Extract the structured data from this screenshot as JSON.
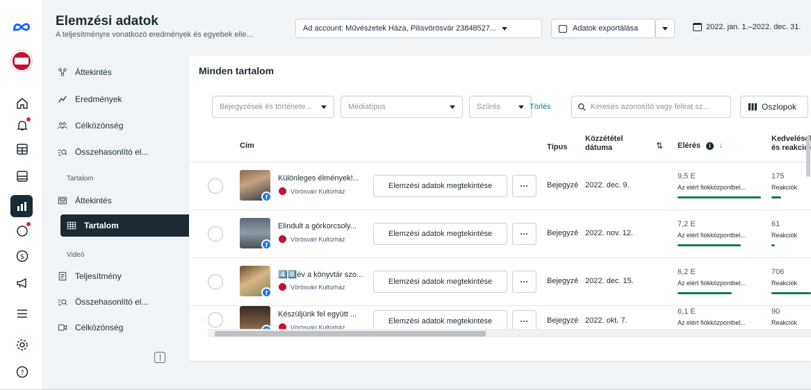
{
  "header": {
    "title": "Elemzési adatok",
    "subtitle": "A teljesítményre vonatkozó eredmények és egyebek elle...",
    "ad_account": "Ad account: Művészetek Háza, Pilisvörösvár 23848527...",
    "export_label": "Adatok exportálása",
    "date_range": "2022. jan. 1.–2022. dec. 31."
  },
  "rail": {
    "items": [
      "meta-logo",
      "page-avatar",
      "home-icon",
      "notifications-icon",
      "table-icon",
      "layout-icon",
      "insights-icon",
      "speech-bubble-icon",
      "dollar-icon",
      "megaphone-icon",
      "menu-icon",
      "settings-icon",
      "help-icon"
    ]
  },
  "nav": {
    "items": [
      {
        "label": "Áttekintés",
        "icon": "overview-icon"
      },
      {
        "label": "Eredmények",
        "icon": "results-icon"
      },
      {
        "label": "Célközönség",
        "icon": "audience-icon"
      },
      {
        "label": "Összehasonlító el...",
        "icon": "compare-icon"
      }
    ],
    "content_section": "Tartalom",
    "content_items": [
      {
        "label": "Áttekintés",
        "icon": "content-overview-icon"
      },
      {
        "label": "Tartalom",
        "icon": "content-table-icon"
      }
    ],
    "video_section": "Videó",
    "video_items": [
      {
        "label": "Teljesítmény",
        "icon": "performance-icon"
      },
      {
        "label": "Összehasonlító el...",
        "icon": "compare-icon"
      },
      {
        "label": "Célközönség",
        "icon": "video-audience-icon"
      }
    ]
  },
  "content": {
    "title": "Minden tartalom",
    "filters": {
      "posts": "Bejegyzések és története...",
      "media_type": "Médiatípus",
      "filter": "Szűrés",
      "clear": "Törlés",
      "search_placeholder": "Keresés azonosító vagy felirat sz...",
      "columns": "Oszlopok"
    },
    "columns": {
      "title": "Cím",
      "type": "Típus",
      "published": "Közzététel dátuma",
      "reach": "Elérés",
      "reactions": "Kedvelések és reakciók"
    },
    "rows": [
      {
        "title": "Különleges élmények!...",
        "page": "Vörösvári Kultúrház",
        "view": "Elemzési adatok megtekintése",
        "type": "Bejegyzé",
        "date": "2022. dec. 9.",
        "reach": "9,5 E",
        "reach_label": "Az elért fiókközpontbel...",
        "reach_fraction": 1.0,
        "reactions": "175",
        "reactions_label": "Reakciók",
        "reactions_fraction": 0.25
      },
      {
        "title": "Elindult a görkorcsoly...",
        "page": "Vörösvári Kultúrház",
        "view": "Elemzési adatok megtekintése",
        "type": "Bejegyzé",
        "date": "2022. nov. 12.",
        "reach": "7,2 E",
        "reach_label": "Az elért fiókközpontbel...",
        "reach_fraction": 0.76,
        "reactions": "61",
        "reactions_label": "Reakciók",
        "reactions_fraction": 0.09
      },
      {
        "title": "4️⃣0️⃣év a könyvtár szo...",
        "page": "Vörösvári Kultúrház",
        "view": "Elemzési adatok megtekintése",
        "type": "Bejegyzé",
        "date": "2022. dec. 15.",
        "reach": "6,2 E",
        "reach_label": "Az elért fiókközpontbel...",
        "reach_fraction": 0.65,
        "reactions": "706",
        "reactions_label": "Reakciók",
        "reactions_fraction": 1.0
      },
      {
        "title": "Készüljünk fel együtt ...",
        "page": "Vörösvári Kultúrház",
        "view": "Elemzési adatok megtekintése",
        "type": "Bejegyzé",
        "date": "2022. okt. 7.",
        "reach": "6,1 E",
        "reach_label": "Az elért fiókközpontbel...",
        "reach_fraction": 0.64,
        "reactions": "90",
        "reactions_label": "Reakciók",
        "reactions_fraction": 0.13
      }
    ]
  },
  "colors": {
    "accent": "#1c2b33",
    "bar": "#0b7a5a",
    "link": "#0a78be",
    "facebook": "#1877f2",
    "notification": "#e41e3f"
  }
}
